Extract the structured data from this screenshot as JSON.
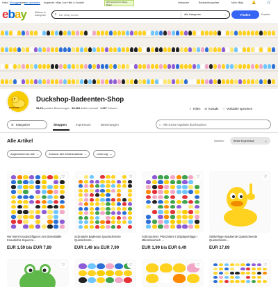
{
  "topbar": {
    "greeting": "Hallo!",
    "signin": "Einloggen",
    "or": "oder",
    "register": "neu anmelden",
    "links": [
      "Angebote",
      "eBay Live",
      "Hilfe & Kontakt"
    ],
    "promo": "20% extra für 2x Shop-Daten",
    "right": [
      "Verkaufen",
      "Beobachtungsliste",
      "Mein eBay"
    ]
  },
  "header": {
    "logo": [
      "e",
      "b",
      "a",
      "y"
    ],
    "shop_by_category": "Stöbern in Kategorien",
    "search_placeholder": "Bei eBay finden",
    "category_select": "Alle Kategorien",
    "find_button": "Finden",
    "advanced": "Erweitert"
  },
  "store": {
    "name": "Duckshop-Badeenten-Shop",
    "logo_text": "DUCKSHOP",
    "positive_pct": "99,2%",
    "positive_label": "positive Bewertungen",
    "sold": "84.363",
    "sold_label": "Artikel verkauft",
    "followers": "1.237",
    "followers_label": "Follower",
    "share": "Teilen",
    "contact": "Kontakt",
    "save_seller": "Verkäufer speichern"
  },
  "nav": {
    "categories": "Kategorien",
    "tabs": [
      "Shoppen",
      "Impressum",
      "Bewertungen"
    ],
    "store_search_placeholder": "Alle 6.544 Angebote durchsuchen"
  },
  "listing": {
    "heading": "Alle Artikel",
    "sort_label": "Sortieren:",
    "sort_value": "Beste Ergebnisse",
    "filters": [
      "Angebotsformat: Alle",
      "Zustand: Alle Artikelzustände",
      "Lieferung:"
    ]
  },
  "products": [
    {
      "title": "Herr Bert Knautschfiguren Anti Stressbälle Knautschis Squeeze...",
      "price": "EUR 1,59 bis EUR 7,89"
    },
    {
      "title": "Schnabels Badeente Quietscheente Quietschente...",
      "price": "EUR 1,49 bis EUR 7,99"
    },
    {
      "title": "Schmoozies I Plüschtiere I Displayeinlage I Mikrofasertuch ...",
      "price": "EUR 1,99 bis EUR 6,49"
    },
    {
      "title": "Stinkefinger Badeente Quietscheente Quietschente...",
      "price": "EUR 17,09"
    }
  ],
  "colors": {
    "accent": "#3665f3",
    "duck_yellow": "#f7cc00",
    "promo_bg": "#e9f8c8"
  }
}
